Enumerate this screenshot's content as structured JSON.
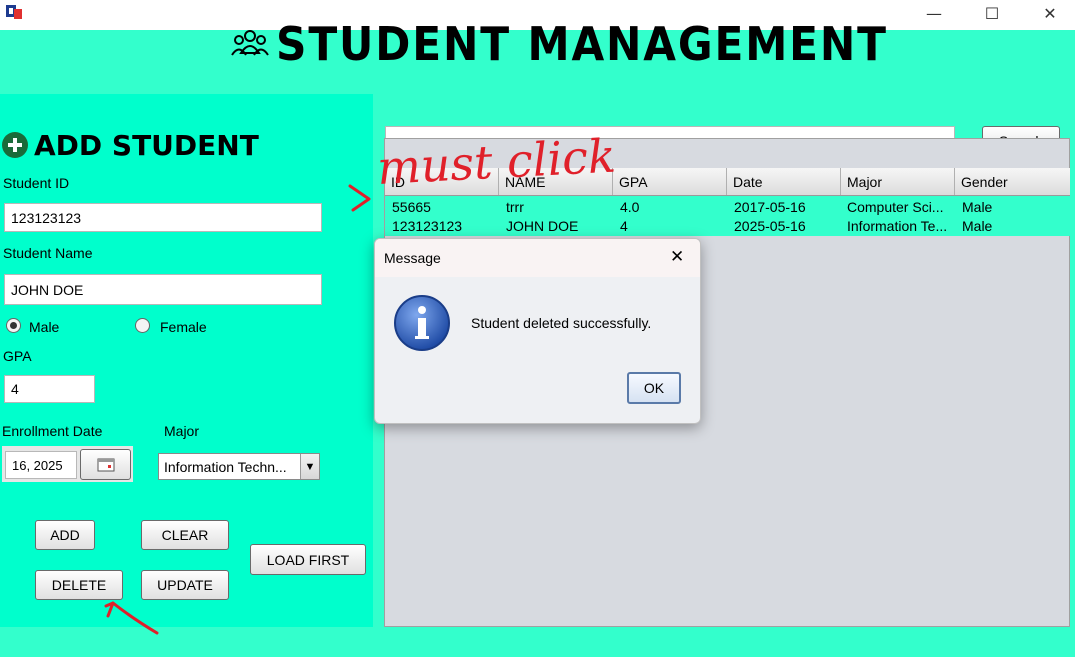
{
  "window": {
    "minimize_glyph": "—",
    "maximize_glyph": "☐",
    "close_glyph": "✕"
  },
  "header": {
    "title": "STUDENT MANAGEMENT"
  },
  "form": {
    "title": "ADD STUDENT",
    "student_id_label": "Student ID",
    "student_id_value": "123123123",
    "student_name_label": "Student Name",
    "student_name_value": "JOHN DOE",
    "gender_male": "Male",
    "gender_female": "Female",
    "gender_selected": "Male",
    "gpa_label": "GPA",
    "gpa_value": "4",
    "enrollment_date_label": "Enrollment Date",
    "enrollment_date_value": "16, 2025",
    "major_label": "Major",
    "major_value": "Information Techn...",
    "buttons": {
      "add": "ADD",
      "clear": "CLEAR",
      "delete": "DELETE",
      "update": "UPDATE",
      "load_first": "LOAD FIRST"
    }
  },
  "search": {
    "value": "",
    "button": "Search"
  },
  "table": {
    "columns": [
      "ID",
      "NAME",
      "GPA",
      "Date",
      "Major",
      "Gender"
    ],
    "rows": [
      [
        "55665",
        "trrr",
        "4.0",
        "2017-05-16",
        "Computer Sci...",
        "Male"
      ],
      [
        "123123123",
        "JOHN DOE",
        "4",
        "2025-05-16",
        "Information Te...",
        "Male"
      ]
    ]
  },
  "dialog": {
    "title": "Message",
    "message": "Student deleted successfully.",
    "ok": "OK",
    "close_glyph": "✕"
  },
  "annotation": {
    "text": "must click",
    "color": "#e0202a"
  },
  "colors": {
    "background": "#33ffcc",
    "panel": "#00ffcc",
    "table_rows": "#33ffcc"
  }
}
